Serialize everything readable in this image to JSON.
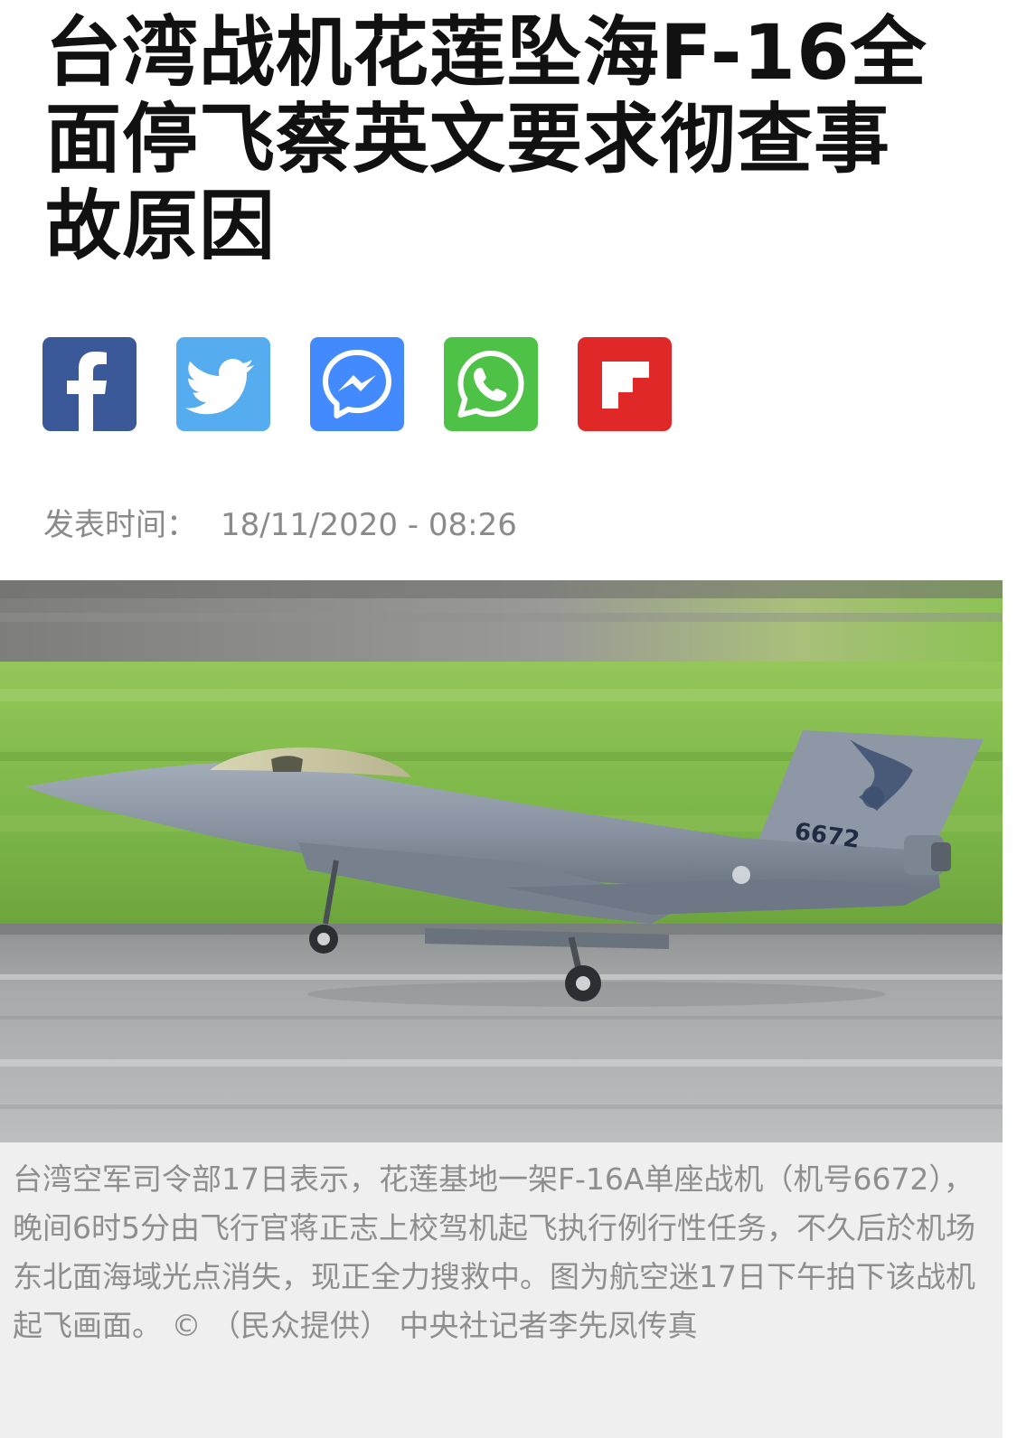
{
  "article": {
    "headline": "台湾战机花莲坠海F-16全面停飞蔡英文要求彻查事故原因",
    "published_label": "发表时间：",
    "published_value": "18/11/2020 - 08:26"
  },
  "share": {
    "buttons": [
      {
        "network": "Facebook",
        "icon": "facebook-icon",
        "color": "#3b5998"
      },
      {
        "network": "Twitter",
        "icon": "twitter-icon",
        "color": "#55acee"
      },
      {
        "network": "Messenger",
        "icon": "messenger-icon",
        "color": "#448aff"
      },
      {
        "network": "WhatsApp",
        "icon": "whatsapp-icon",
        "color": "#4dc247"
      },
      {
        "network": "Flipboard",
        "icon": "flipboard-icon",
        "color": "#e12828"
      }
    ]
  },
  "photo": {
    "tail_number": "6672",
    "caption": "台湾空军司令部17日表示，花莲基地一架F-16A单座战机（机号6672），晚间6时5分由飞行官蒋正志上校驾机起飞执行例行性任务，不久后於机场东北面海域光点消失，现正全力搜救中。图为航空迷17日下午拍下该战机起飞画面。 © （民众提供） 中央社记者李先凤传真"
  }
}
